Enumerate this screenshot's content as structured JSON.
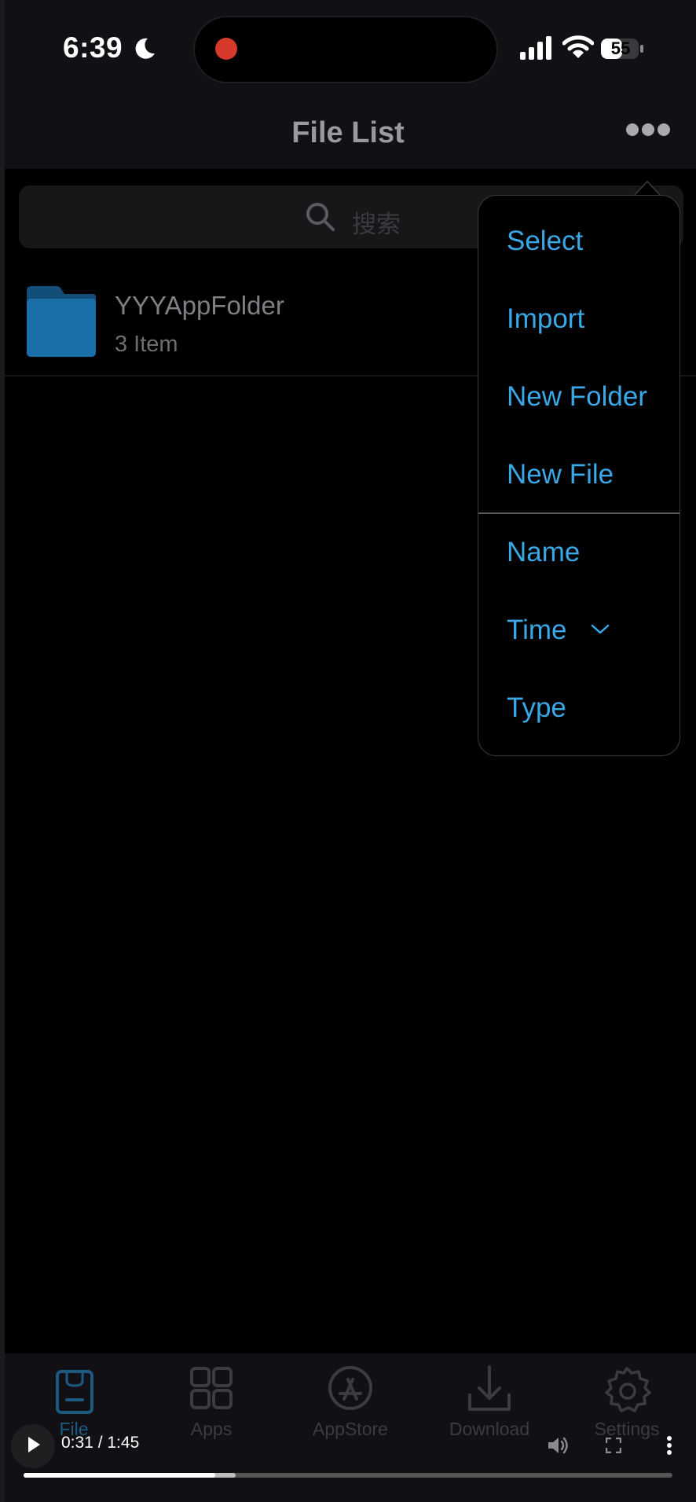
{
  "status_bar": {
    "time": "6:39",
    "battery": "55",
    "icons": [
      "moon-icon",
      "recording-indicator",
      "cellular-signal-icon",
      "wifi-icon",
      "battery-icon"
    ]
  },
  "nav": {
    "title": "File List",
    "more_icon": "ellipsis-icon"
  },
  "search": {
    "placeholder": "搜索",
    "icon": "search-icon"
  },
  "folders": [
    {
      "name": "YYYAppFolder",
      "count": "3 Item",
      "icon": "folder-icon"
    }
  ],
  "menu": {
    "actions": [
      "Select",
      "Import",
      "New Folder",
      "New File"
    ],
    "sort": [
      {
        "label": "Name",
        "selected": false
      },
      {
        "label": "Time",
        "selected": true
      },
      {
        "label": "Type",
        "selected": false
      }
    ]
  },
  "tabs": [
    {
      "label": "File",
      "icon": "file-bag-icon",
      "active": true
    },
    {
      "label": "Apps",
      "icon": "apps-grid-icon",
      "active": false
    },
    {
      "label": "AppStore",
      "icon": "appstore-icon",
      "active": false
    },
    {
      "label": "Download",
      "icon": "download-icon",
      "active": false
    },
    {
      "label": "Settings",
      "icon": "gear-icon",
      "active": false
    }
  ],
  "video_player": {
    "time_display": "0:31 / 1:45",
    "progress_fraction": 0.295,
    "icons": [
      "play-icon",
      "volume-icon",
      "fullscreen-icon",
      "more-vertical-icon"
    ]
  },
  "colors": {
    "accent": "#3aa7e6",
    "active_tab": "#1d5a82",
    "recording": "#d8392b",
    "folder": "#1a6fa8"
  }
}
